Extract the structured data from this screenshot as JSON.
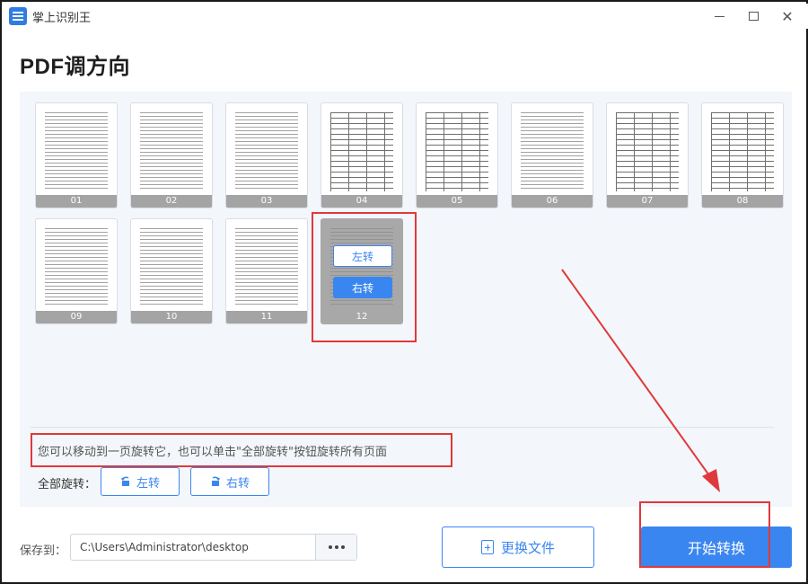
{
  "app": {
    "title": "掌上识别王"
  },
  "page": {
    "title": "PDF调方向"
  },
  "thumbs": [
    {
      "num": "01"
    },
    {
      "num": "02"
    },
    {
      "num": "03"
    },
    {
      "num": "04"
    },
    {
      "num": "05"
    },
    {
      "num": "06"
    },
    {
      "num": "07"
    },
    {
      "num": "08"
    },
    {
      "num": "09"
    },
    {
      "num": "10"
    },
    {
      "num": "11"
    },
    {
      "num": "12"
    }
  ],
  "active_thumb": {
    "rotate_left": "左转",
    "rotate_right": "右转"
  },
  "hint": "您可以移动到一页旋转它，也可以单击\"全部旋转\"按钮旋转所有页面",
  "rotate_all": {
    "label": "全部旋转：",
    "left": "左转",
    "right": "右转"
  },
  "save": {
    "label": "保存到：",
    "path": "C:\\Users\\Administrator\\desktop"
  },
  "buttons": {
    "change_file": "更换文件",
    "start": "开始转换"
  },
  "colors": {
    "accent": "#3a86f0",
    "annotation": "#e0393b"
  }
}
